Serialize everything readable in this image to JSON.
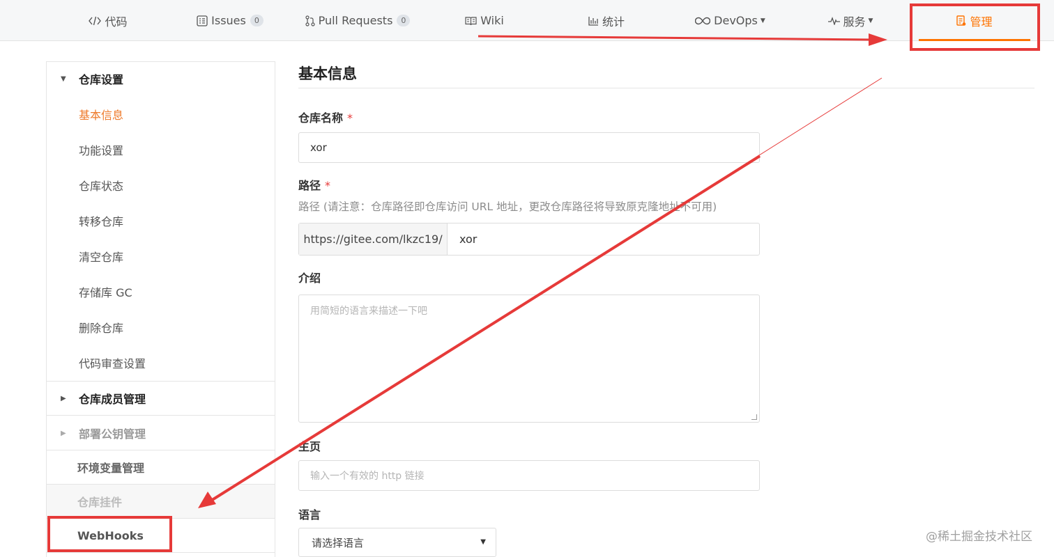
{
  "nav": {
    "tabs": [
      {
        "label": "代码",
        "icon": "code-icon"
      },
      {
        "label": "Issues",
        "badge": "0",
        "icon": "issues-icon"
      },
      {
        "label": "Pull Requests",
        "badge": "0",
        "icon": "pull-request-icon"
      },
      {
        "label": "Wiki",
        "icon": "book-icon"
      },
      {
        "label": "统计",
        "icon": "bar-chart-icon"
      },
      {
        "label": "DevOps",
        "icon": "infinity-icon",
        "dropdown": true
      },
      {
        "label": "服务",
        "icon": "pulse-icon",
        "dropdown": true
      },
      {
        "label": "管理",
        "icon": "manage-icon",
        "active": true
      }
    ]
  },
  "sidebar": {
    "repo_settings": {
      "title": "仓库设置",
      "items": [
        "基本信息",
        "功能设置",
        "仓库状态",
        "转移仓库",
        "清空仓库",
        "存储库 GC",
        "删除仓库",
        "代码审查设置"
      ]
    },
    "members": "仓库成员管理",
    "deploy_keys": "部署公钥管理",
    "env_vars": "环境变量管理",
    "plugins": "仓库挂件",
    "webhooks": "WebHooks"
  },
  "form": {
    "title": "基本信息",
    "name_label": "仓库名称",
    "required_mark": "*",
    "name_value": "xor",
    "path_label": "路径",
    "path_hint": "路径 (请注意：仓库路径即仓库访问 URL 地址，更改仓库路径将导致原克隆地址不可用)",
    "path_prefix": "https://gitee.com/lkzc19/",
    "path_value": "xor",
    "intro_label": "介绍",
    "intro_placeholder": "用简短的语言来描述一下吧",
    "homepage_label": "主页",
    "homepage_placeholder": "输入一个有效的 http 链接",
    "language_label": "语言",
    "language_placeholder": "请选择语言"
  },
  "watermark": "@稀土掘金技术社区",
  "colors": {
    "accent": "#fe7300",
    "annotation": "#e63a39"
  }
}
